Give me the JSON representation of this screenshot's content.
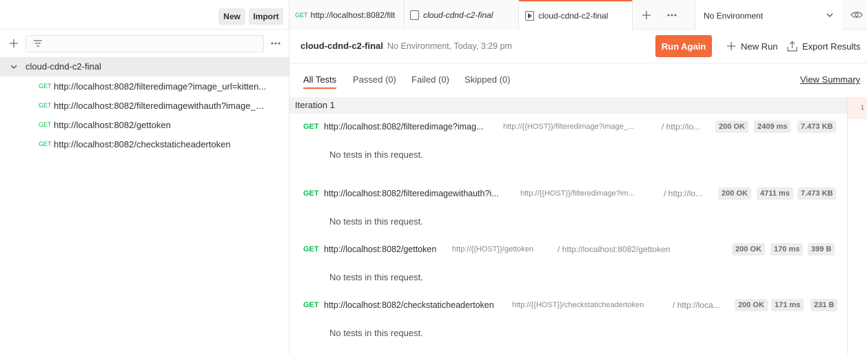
{
  "sidebar": {
    "new_label": "New",
    "import_label": "Import",
    "collection_name": "cloud-cdnd-c2-final",
    "requests": [
      {
        "method": "GET",
        "url": "http://localhost:8082/filteredimage?image_url=kitten..."
      },
      {
        "method": "GET",
        "url": "http://localhost:8082/filteredimagewithauth?image_u..."
      },
      {
        "method": "GET",
        "url": "http://localhost:8082/gettoken"
      },
      {
        "method": "GET",
        "url": "http://localhost:8082/checkstaticheadertoken"
      }
    ]
  },
  "tabs": [
    {
      "method": "GET",
      "label": "http://localhost:8082/filt"
    },
    {
      "label": "cloud-cdnd-c2-final"
    },
    {
      "label": "cloud-cdnd-c2-final"
    }
  ],
  "environment": {
    "selected": "No Environment"
  },
  "run": {
    "title": "cloud-cdnd-c2-final",
    "meta": "No Environment, Today, 3:29 pm",
    "run_again": "Run Again",
    "new_run": "New Run",
    "export": "Export Results"
  },
  "filters": {
    "all": "All Tests",
    "passed": "Passed (0)",
    "failed": "Failed (0)",
    "skipped": "Skipped (0)",
    "view_summary": "View Summary"
  },
  "iteration": {
    "label": "Iteration 1",
    "rail_number": "1"
  },
  "results": [
    {
      "method": "GET",
      "url": "http://localhost:8082/filteredimage?imag...",
      "template": "http://{{HOST}}/filteredimage?image_...",
      "path": "/ http://lo...",
      "status": "200 OK",
      "time": "2409 ms",
      "size": "7.473 KB",
      "note": "No tests in this request."
    },
    {
      "method": "GET",
      "url": "http://localhost:8082/filteredimagewithauth?i...",
      "template": "http://{{HOST}}/filteredimage?im...",
      "path": "/ http://lo...",
      "status": "200 OK",
      "time": "4711 ms",
      "size": "7.473 KB",
      "note": "No tests in this request."
    },
    {
      "method": "GET",
      "url": "http://localhost:8082/gettoken",
      "template": "http://{{HOST}}/gettoken",
      "path": "/ http://localhost:8082/gettoken",
      "status": "200 OK",
      "time": "170 ms",
      "size": "399 B",
      "note": "No tests in this request."
    },
    {
      "method": "GET",
      "url": "http://localhost:8082/checkstaticheadertoken",
      "template": "http://{{HOST}}/checkstaticheadertoken",
      "path": "/ http://loca...",
      "status": "200 OK",
      "time": "171 ms",
      "size": "231 B",
      "note": "No tests in this request."
    }
  ],
  "colors": {
    "accent": "#f26b3a",
    "get_method": "#0cbb52"
  }
}
